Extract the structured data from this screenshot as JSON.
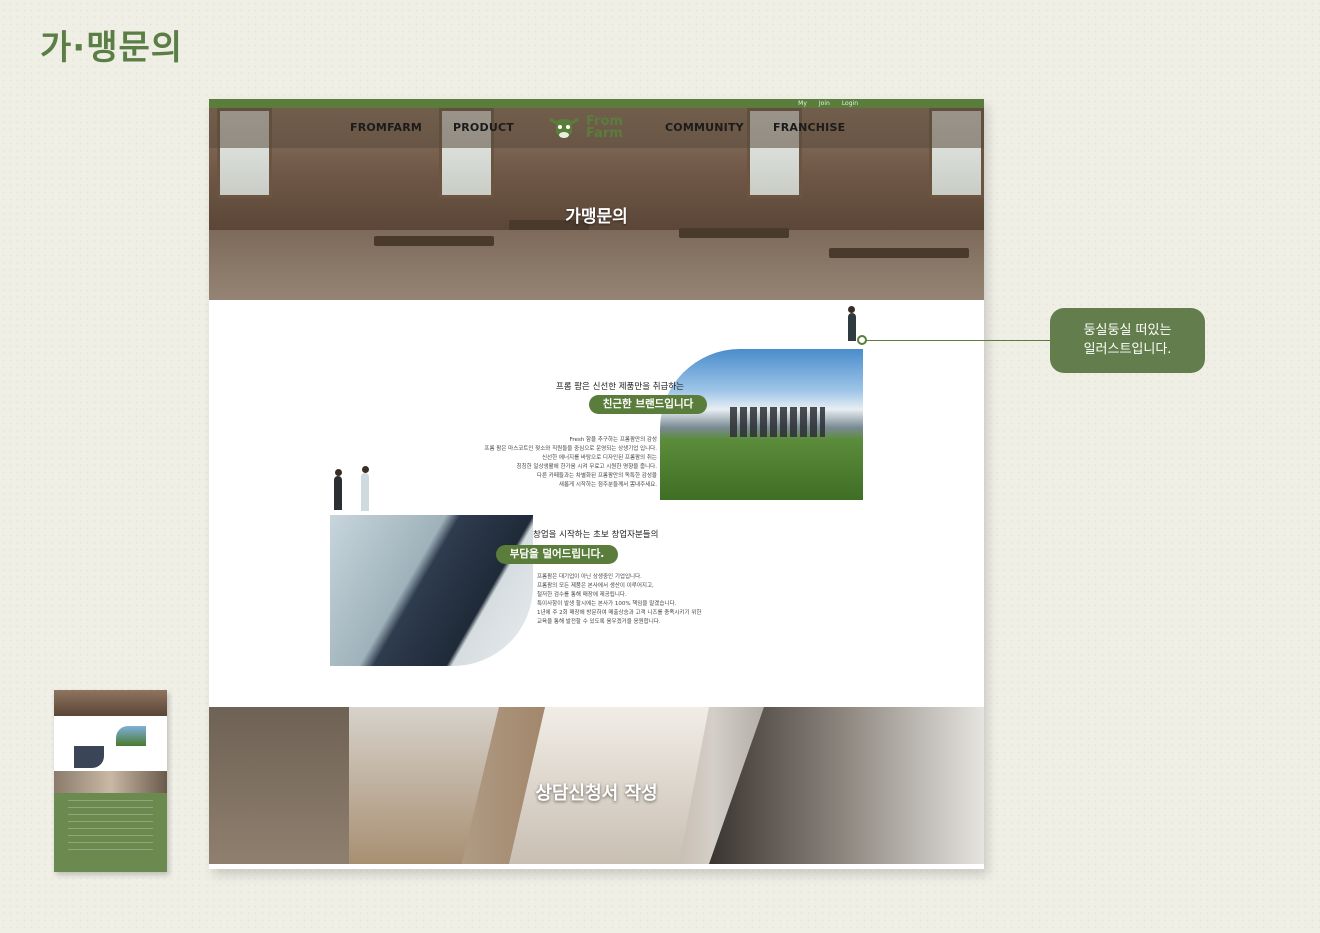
{
  "page": {
    "heading": "가·맹문의"
  },
  "mockup": {
    "top_links": [
      "My",
      "Join",
      "Login"
    ],
    "nav": [
      "FROMFARM",
      "PRODUCT",
      "COMMUNITY",
      "FRANCHISE"
    ],
    "logo": {
      "line1": "From",
      "line2": "Farm"
    },
    "hero_title": "가맹문의",
    "section1": {
      "lead": "프롬 팜은 신선한 제품만을 취급하는",
      "highlight": "친근한 브랜드입니다",
      "paragraph": [
        "Fresh 함을 추구하는 프롬팜만의 감성",
        "프롬 팜은 마스코트인 젖소와 직원들을 중심으로 운영되는 상생기업 입니다.",
        "신선한 에너지를 바탕으로 디자인된 프롬팜의 취는",
        "칭칭한 일상생활에 한가움 시켜 무료고 시원한 명향을 줍니다.",
        "다른 카페들과는 차별화된 프롬팜만의 독특한 감성을",
        "새롭게 시작하는 점주분들께서 뽐내주세요."
      ]
    },
    "section2": {
      "lead": "창업을 시작하는 초보 창업자분들의",
      "highlight": "부담을 덜어드립니다.",
      "paragraph": [
        "프롬팜은 대기업이 아닌 상생중인 기업입니다.",
        "프롬팜의 모든 제품은 본사에서 생산이 이루어지고,",
        "철저한 검수를 통해 매장에 제공됩니다.",
        "특이사항이 발생 할시에는 본사가 100% 책임을 말겠습니다.",
        "1년에 주 2회 매장에 방문하여 매출상승과 고객 니즈를 충족시키기 위한",
        "교육을 통해 발전할 수 있도록 움우겠거을 응원합니다."
      ]
    },
    "consult_title": "상담신청서 작성"
  },
  "callout": {
    "line1": "둥실둥실 떠있는",
    "line2": "일러스트입니다."
  },
  "colors": {
    "brand_green": "#5b7d3c",
    "callout_green": "#637e4c",
    "background": "#efefe6"
  }
}
